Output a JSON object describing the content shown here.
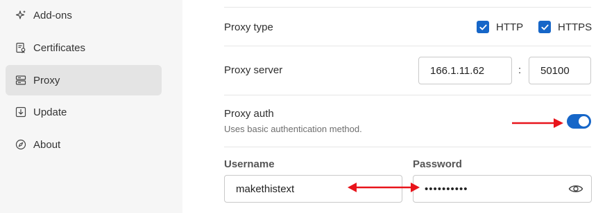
{
  "sidebar": {
    "items": [
      {
        "label": "Add-ons",
        "icon": "sparkle-icon"
      },
      {
        "label": "Certificates",
        "icon": "certificate-icon"
      },
      {
        "label": "Proxy",
        "icon": "server-icon",
        "active": true
      },
      {
        "label": "Update",
        "icon": "download-icon"
      },
      {
        "label": "About",
        "icon": "compass-icon"
      }
    ]
  },
  "proxy_type": {
    "label": "Proxy type",
    "http_label": "HTTP",
    "https_label": "HTTPS",
    "http_checked": true,
    "https_checked": true
  },
  "proxy_server": {
    "label": "Proxy server",
    "host": "166.1.11.62",
    "separator": ":",
    "port": "50100"
  },
  "proxy_auth": {
    "label": "Proxy auth",
    "description": "Uses basic authentication method.",
    "enabled": true
  },
  "credentials": {
    "username_label": "Username",
    "username_value": "makethistext",
    "password_label": "Password",
    "password_value": "••••••••••"
  },
  "colors": {
    "accent": "#1666c8",
    "annotation_arrow": "#e8141b",
    "sidebar_bg": "#f6f6f6",
    "active_item_bg": "#e4e4e4"
  }
}
